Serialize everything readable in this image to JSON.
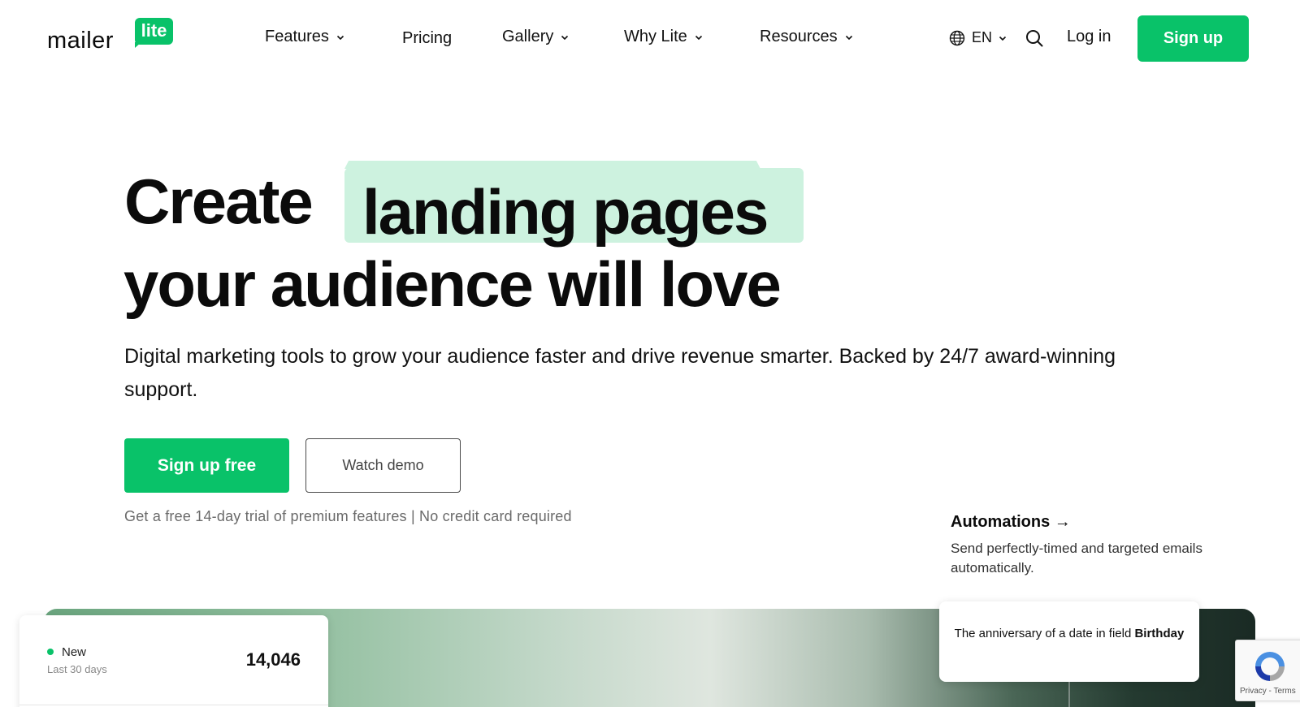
{
  "header": {
    "logo_word": "mailer",
    "logo_badge": "lite",
    "nav": [
      {
        "label": "Features",
        "has_dropdown": true
      },
      {
        "label": "Pricing",
        "has_dropdown": false
      },
      {
        "label": "Gallery",
        "has_dropdown": true
      },
      {
        "label": "Why Lite",
        "has_dropdown": true
      },
      {
        "label": "Resources",
        "has_dropdown": true
      }
    ],
    "language": "EN",
    "icons": {
      "language": "globe-icon",
      "search": "search-icon",
      "dropdown": "chevron-down-icon"
    },
    "login_label": "Log in",
    "signup_label": "Sign up"
  },
  "hero": {
    "title_word1": "Create",
    "title_highlight": "landing pages",
    "title_line2": "your audience will love",
    "subtitle": "Digital marketing tools to grow your audience faster and drive revenue smarter. Backed by 24/7 award-winning support.",
    "primary_cta": "Sign up free",
    "secondary_cta": "Watch demo",
    "trial_note": "Get a free 14-day trial of premium features | No credit card required"
  },
  "feature_callout": {
    "title": "Automations",
    "arrow": "→",
    "description": "Send perfectly-timed and targeted emails automatically."
  },
  "stat_card": {
    "label": "New",
    "period": "Last 30 days",
    "value": "14,046"
  },
  "trigger_card": {
    "text": "The anniversary of a date in field",
    "field": "Birthday"
  },
  "recaptcha": {
    "links": "Privacy - Terms",
    "icon": "recaptcha-icon"
  },
  "colors": {
    "brand": "#09c269",
    "highlight": "#cdf2df",
    "text": "#0b0b0b",
    "muted": "#6a6a6a"
  }
}
